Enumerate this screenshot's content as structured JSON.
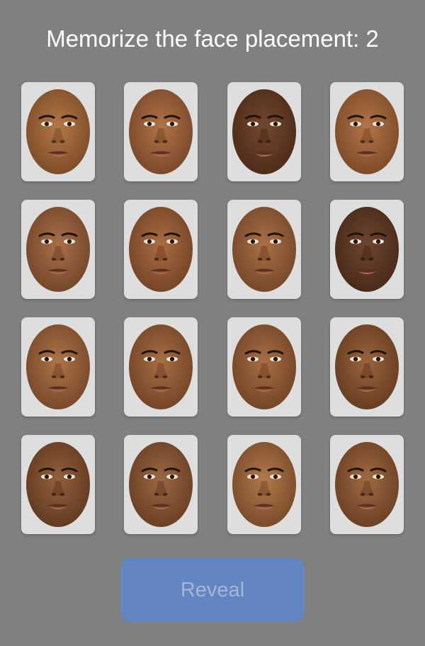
{
  "header": {
    "title": "Memorize the face placement: 2"
  },
  "faces": [
    {
      "skin": "#b37848",
      "dark": "#7a4a26"
    },
    {
      "skin": "#b07448",
      "dark": "#774628"
    },
    {
      "skin": "#74482f",
      "dark": "#4a2a18"
    },
    {
      "skin": "#b27649",
      "dark": "#7a4826"
    },
    {
      "skin": "#a8704a",
      "dark": "#724428"
    },
    {
      "skin": "#a86e44",
      "dark": "#724224"
    },
    {
      "skin": "#a97148",
      "dark": "#734526"
    },
    {
      "skin": "#6f4630",
      "dark": "#462818"
    },
    {
      "skin": "#ad754a",
      "dark": "#754627"
    },
    {
      "skin": "#a66f44",
      "dark": "#714224"
    },
    {
      "skin": "#a66f44",
      "dark": "#714224"
    },
    {
      "skin": "#9a653d",
      "dark": "#643a1f"
    },
    {
      "skin": "#93603d",
      "dark": "#5f381f"
    },
    {
      "skin": "#9c6843",
      "dark": "#663d22"
    },
    {
      "skin": "#b07a4c",
      "dark": "#774828"
    },
    {
      "skin": "#a06a42",
      "dark": "#683e21"
    }
  ],
  "actions": {
    "reveal_label": "Reveal"
  }
}
